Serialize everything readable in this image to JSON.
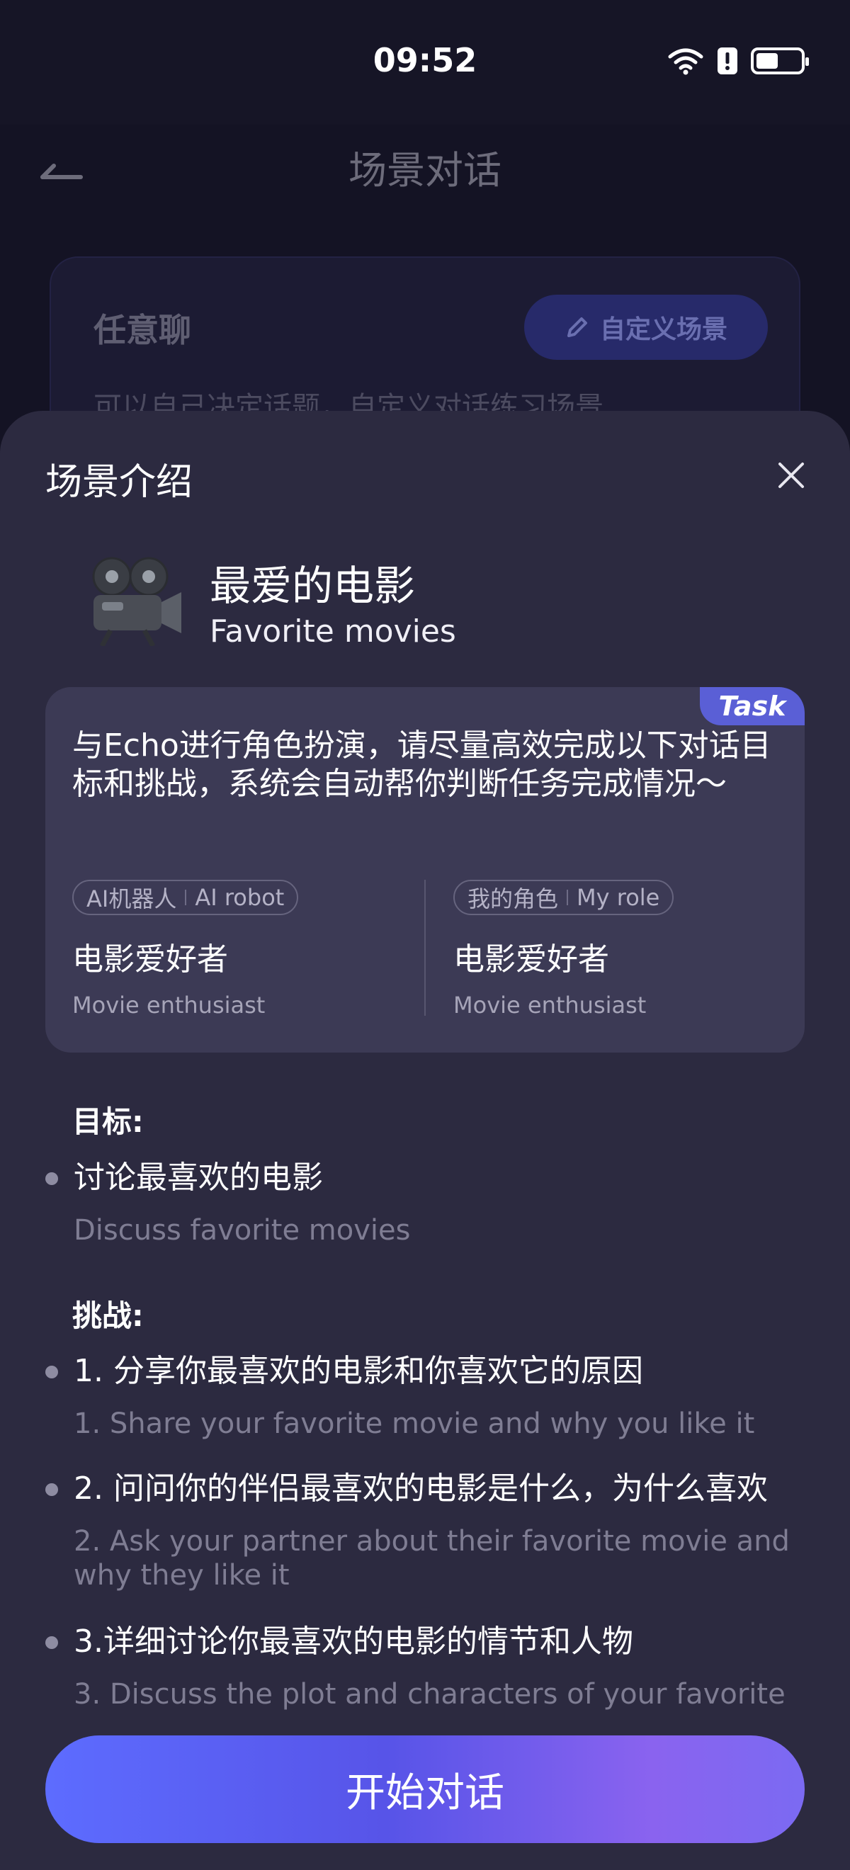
{
  "status": {
    "time": "09:52",
    "battery_percent": 50
  },
  "background": {
    "title": "场景对话",
    "card_title": "任意聊",
    "custom_button": "自定义场景",
    "card_desc": "可以自己决定话题，自定义对话练习场景"
  },
  "sheet": {
    "title": "场景介绍",
    "scene": {
      "title_zh": "最爱的电影",
      "title_en": "Favorite movies",
      "icon": "movie-camera-icon"
    },
    "task": {
      "badge": "Task",
      "text": "与Echo进行角色扮演，请尽量高效完成以下对话目标和挑战，系统会自动帮你判断任务完成情况～",
      "ai_role": {
        "pill_zh": "AI机器人",
        "pill_en": "AI robot",
        "name_zh": "电影爱好者",
        "name_en": "Movie enthusiast"
      },
      "my_role": {
        "pill_zh": "我的角色",
        "pill_en": "My role",
        "name_zh": "电影爱好者",
        "name_en": "Movie enthusiast"
      }
    },
    "goal_label": "目标:",
    "goal": {
      "zh": "讨论最喜欢的电影",
      "en": "Discuss favorite movies"
    },
    "challenge_label": "挑战:",
    "challenges": [
      {
        "zh": "1. 分享你最喜欢的电影和你喜欢它的原因",
        "en": "1. Share your favorite movie and why you like it"
      },
      {
        "zh": "2. 问问你的伴侣最喜欢的电影是什么，为什么喜欢",
        "en": "2. Ask your partner about their favorite movie and why they like it"
      },
      {
        "zh": "3.详细讨论你最喜欢的电影的情节和人物",
        "en": "3. Discuss the plot and characters of your favorite"
      }
    ],
    "start_button": "开始对话"
  },
  "colors": {
    "accent": "#5a5fd6",
    "sheet_bg": "#2c2a40",
    "card_bg": "#3c3a55"
  }
}
